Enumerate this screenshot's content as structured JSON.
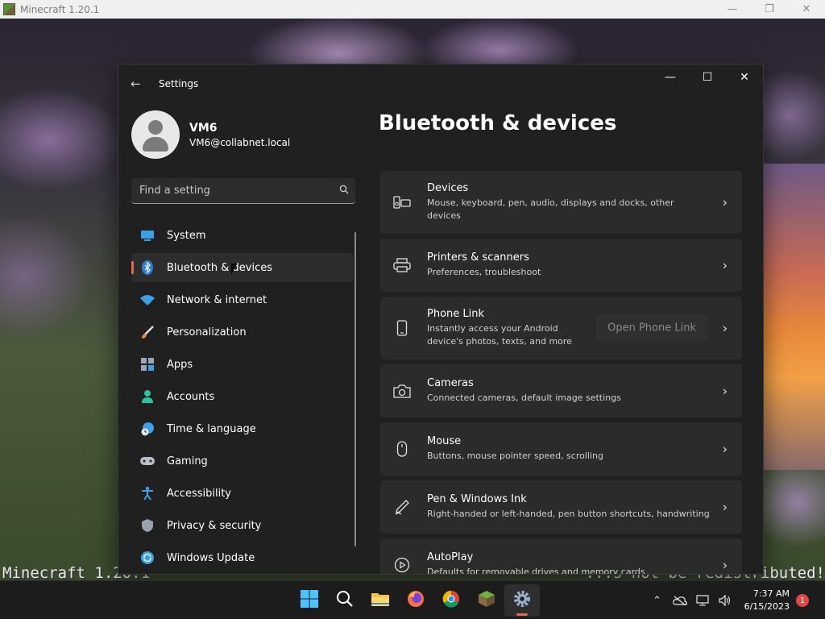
{
  "minecraft": {
    "window_title": "Minecraft 1.20.1",
    "overlay_left": "Minecraft 1.20.1",
    "overlay_right": "...s not be redistributed!"
  },
  "settings": {
    "app_title": "Settings",
    "profile": {
      "name": "VM6",
      "email": "VM6@collabnet.local"
    },
    "search": {
      "placeholder": "Find a setting"
    },
    "nav": [
      {
        "label": "System",
        "icon": "monitor-icon"
      },
      {
        "label": "Bluetooth & devices",
        "icon": "bluetooth-icon"
      },
      {
        "label": "Network & internet",
        "icon": "wifi-icon"
      },
      {
        "label": "Personalization",
        "icon": "brush-icon"
      },
      {
        "label": "Apps",
        "icon": "apps-icon"
      },
      {
        "label": "Accounts",
        "icon": "person-icon"
      },
      {
        "label": "Time & language",
        "icon": "globe-clock-icon"
      },
      {
        "label": "Gaming",
        "icon": "gamepad-icon"
      },
      {
        "label": "Accessibility",
        "icon": "accessibility-icon"
      },
      {
        "label": "Privacy & security",
        "icon": "shield-icon"
      },
      {
        "label": "Windows Update",
        "icon": "update-icon"
      }
    ],
    "selected_nav": "Bluetooth & devices",
    "page_title": "Bluetooth & devices",
    "cards": [
      {
        "title": "Devices",
        "subtitle": "Mouse, keyboard, pen, audio, displays and docks, other devices",
        "icon": "keyboard-speaker-icon"
      },
      {
        "title": "Printers & scanners",
        "subtitle": "Preferences, troubleshoot",
        "icon": "printer-icon"
      },
      {
        "title": "Phone Link",
        "subtitle": "Instantly access your Android device's photos, texts, and more",
        "icon": "phone-icon",
        "button": "Open Phone Link"
      },
      {
        "title": "Cameras",
        "subtitle": "Connected cameras, default image settings",
        "icon": "camera-icon"
      },
      {
        "title": "Mouse",
        "subtitle": "Buttons, mouse pointer speed, scrolling",
        "icon": "mouse-icon"
      },
      {
        "title": "Pen & Windows Ink",
        "subtitle": "Right-handed or left-handed, pen button shortcuts, handwriting",
        "icon": "pen-icon"
      },
      {
        "title": "AutoPlay",
        "subtitle": "Defaults for removable drives and memory cards",
        "icon": "autoplay-icon"
      }
    ]
  },
  "taskbar": {
    "time": "7:37 AM",
    "date": "6/15/2023",
    "notification_count": "1"
  },
  "colors": {
    "accent": "#e06d4a",
    "window_bg": "#202020",
    "card_bg": "#2b2b2b"
  }
}
